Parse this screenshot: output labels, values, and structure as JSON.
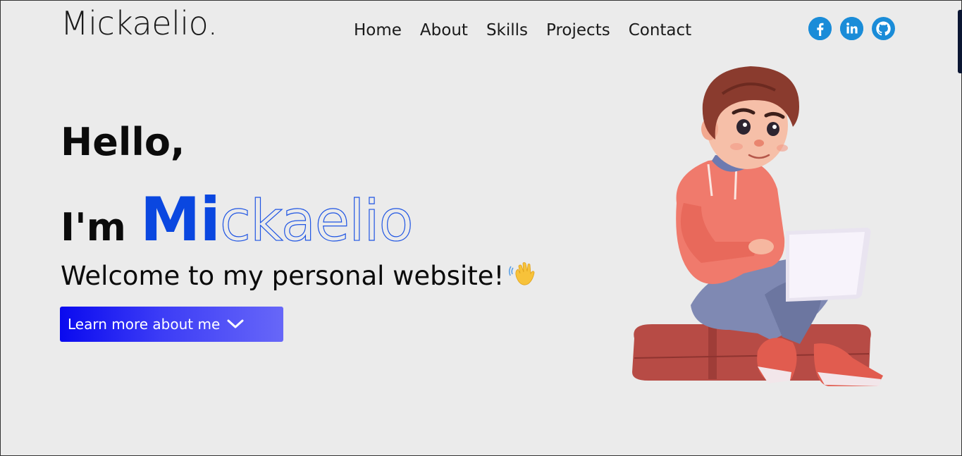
{
  "header": {
    "brand": "Mickaelio.",
    "nav": [
      {
        "label": "Home"
      },
      {
        "label": "About"
      },
      {
        "label": "Skills"
      },
      {
        "label": "Projects"
      },
      {
        "label": "Contact"
      }
    ],
    "socials": [
      {
        "icon": "facebook-icon"
      },
      {
        "icon": "linkedin-icon"
      },
      {
        "icon": "github-icon"
      }
    ]
  },
  "hero": {
    "greeting": "Hello,",
    "im": "I'm",
    "name_filled": "Mi",
    "name_outline": "ckaelio",
    "welcome": "Welcome to my personal website!",
    "wave_icon": "waving-hand-icon",
    "cta_label": "Learn more about me",
    "cta_icon": "chevron-down-icon"
  },
  "colors": {
    "background": "#ebebeb",
    "accent": "#0a47e0",
    "social": "#1a8cd8",
    "cta_start": "#0a0aef",
    "cta_end": "#6767f8"
  }
}
